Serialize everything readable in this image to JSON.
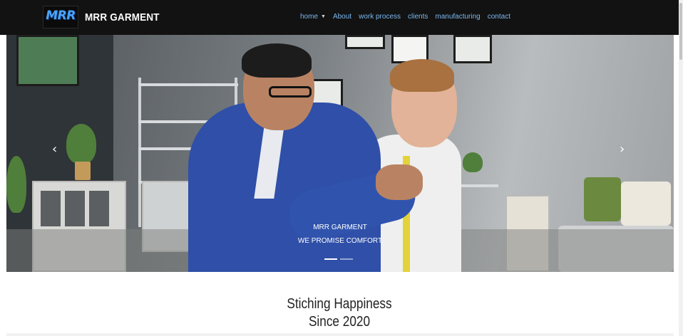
{
  "navbar": {
    "logo_text": "MRR",
    "brand_name": "MRR GARMENT",
    "items": [
      {
        "label": "home",
        "has_dropdown": true
      },
      {
        "label": "About"
      },
      {
        "label": "work process"
      },
      {
        "label": "clients"
      },
      {
        "label": "manufacturing"
      },
      {
        "label": "contact"
      }
    ],
    "colors": {
      "background": "#121212",
      "link": "#7ab8f0"
    }
  },
  "carousel": {
    "caption_title": "MRR GARMENT",
    "caption_subtitle": "WE PROMISE COMFORT",
    "prev_icon": "‹",
    "next_icon": "›",
    "slide_count": 2,
    "active_slide": 1
  },
  "section": {
    "heading_line1": "Stiching Happiness",
    "heading_line2": "Since 2020"
  }
}
